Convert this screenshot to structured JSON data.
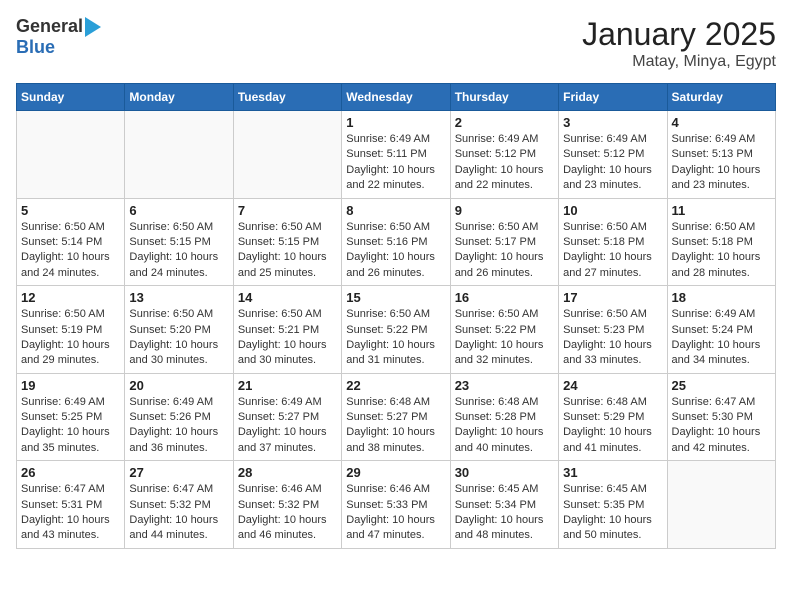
{
  "header": {
    "logo_general": "General",
    "logo_blue": "Blue",
    "title": "January 2025",
    "subtitle": "Matay, Minya, Egypt"
  },
  "weekdays": [
    "Sunday",
    "Monday",
    "Tuesday",
    "Wednesday",
    "Thursday",
    "Friday",
    "Saturday"
  ],
  "weeks": [
    [
      {
        "day": "",
        "info": ""
      },
      {
        "day": "",
        "info": ""
      },
      {
        "day": "",
        "info": ""
      },
      {
        "day": "1",
        "info": "Sunrise: 6:49 AM\nSunset: 5:11 PM\nDaylight: 10 hours\nand 22 minutes."
      },
      {
        "day": "2",
        "info": "Sunrise: 6:49 AM\nSunset: 5:12 PM\nDaylight: 10 hours\nand 22 minutes."
      },
      {
        "day": "3",
        "info": "Sunrise: 6:49 AM\nSunset: 5:12 PM\nDaylight: 10 hours\nand 23 minutes."
      },
      {
        "day": "4",
        "info": "Sunrise: 6:49 AM\nSunset: 5:13 PM\nDaylight: 10 hours\nand 23 minutes."
      }
    ],
    [
      {
        "day": "5",
        "info": "Sunrise: 6:50 AM\nSunset: 5:14 PM\nDaylight: 10 hours\nand 24 minutes."
      },
      {
        "day": "6",
        "info": "Sunrise: 6:50 AM\nSunset: 5:15 PM\nDaylight: 10 hours\nand 24 minutes."
      },
      {
        "day": "7",
        "info": "Sunrise: 6:50 AM\nSunset: 5:15 PM\nDaylight: 10 hours\nand 25 minutes."
      },
      {
        "day": "8",
        "info": "Sunrise: 6:50 AM\nSunset: 5:16 PM\nDaylight: 10 hours\nand 26 minutes."
      },
      {
        "day": "9",
        "info": "Sunrise: 6:50 AM\nSunset: 5:17 PM\nDaylight: 10 hours\nand 26 minutes."
      },
      {
        "day": "10",
        "info": "Sunrise: 6:50 AM\nSunset: 5:18 PM\nDaylight: 10 hours\nand 27 minutes."
      },
      {
        "day": "11",
        "info": "Sunrise: 6:50 AM\nSunset: 5:18 PM\nDaylight: 10 hours\nand 28 minutes."
      }
    ],
    [
      {
        "day": "12",
        "info": "Sunrise: 6:50 AM\nSunset: 5:19 PM\nDaylight: 10 hours\nand 29 minutes."
      },
      {
        "day": "13",
        "info": "Sunrise: 6:50 AM\nSunset: 5:20 PM\nDaylight: 10 hours\nand 30 minutes."
      },
      {
        "day": "14",
        "info": "Sunrise: 6:50 AM\nSunset: 5:21 PM\nDaylight: 10 hours\nand 30 minutes."
      },
      {
        "day": "15",
        "info": "Sunrise: 6:50 AM\nSunset: 5:22 PM\nDaylight: 10 hours\nand 31 minutes."
      },
      {
        "day": "16",
        "info": "Sunrise: 6:50 AM\nSunset: 5:22 PM\nDaylight: 10 hours\nand 32 minutes."
      },
      {
        "day": "17",
        "info": "Sunrise: 6:50 AM\nSunset: 5:23 PM\nDaylight: 10 hours\nand 33 minutes."
      },
      {
        "day": "18",
        "info": "Sunrise: 6:49 AM\nSunset: 5:24 PM\nDaylight: 10 hours\nand 34 minutes."
      }
    ],
    [
      {
        "day": "19",
        "info": "Sunrise: 6:49 AM\nSunset: 5:25 PM\nDaylight: 10 hours\nand 35 minutes."
      },
      {
        "day": "20",
        "info": "Sunrise: 6:49 AM\nSunset: 5:26 PM\nDaylight: 10 hours\nand 36 minutes."
      },
      {
        "day": "21",
        "info": "Sunrise: 6:49 AM\nSunset: 5:27 PM\nDaylight: 10 hours\nand 37 minutes."
      },
      {
        "day": "22",
        "info": "Sunrise: 6:48 AM\nSunset: 5:27 PM\nDaylight: 10 hours\nand 38 minutes."
      },
      {
        "day": "23",
        "info": "Sunrise: 6:48 AM\nSunset: 5:28 PM\nDaylight: 10 hours\nand 40 minutes."
      },
      {
        "day": "24",
        "info": "Sunrise: 6:48 AM\nSunset: 5:29 PM\nDaylight: 10 hours\nand 41 minutes."
      },
      {
        "day": "25",
        "info": "Sunrise: 6:47 AM\nSunset: 5:30 PM\nDaylight: 10 hours\nand 42 minutes."
      }
    ],
    [
      {
        "day": "26",
        "info": "Sunrise: 6:47 AM\nSunset: 5:31 PM\nDaylight: 10 hours\nand 43 minutes."
      },
      {
        "day": "27",
        "info": "Sunrise: 6:47 AM\nSunset: 5:32 PM\nDaylight: 10 hours\nand 44 minutes."
      },
      {
        "day": "28",
        "info": "Sunrise: 6:46 AM\nSunset: 5:32 PM\nDaylight: 10 hours\nand 46 minutes."
      },
      {
        "day": "29",
        "info": "Sunrise: 6:46 AM\nSunset: 5:33 PM\nDaylight: 10 hours\nand 47 minutes."
      },
      {
        "day": "30",
        "info": "Sunrise: 6:45 AM\nSunset: 5:34 PM\nDaylight: 10 hours\nand 48 minutes."
      },
      {
        "day": "31",
        "info": "Sunrise: 6:45 AM\nSunset: 5:35 PM\nDaylight: 10 hours\nand 50 minutes."
      },
      {
        "day": "",
        "info": ""
      }
    ]
  ]
}
